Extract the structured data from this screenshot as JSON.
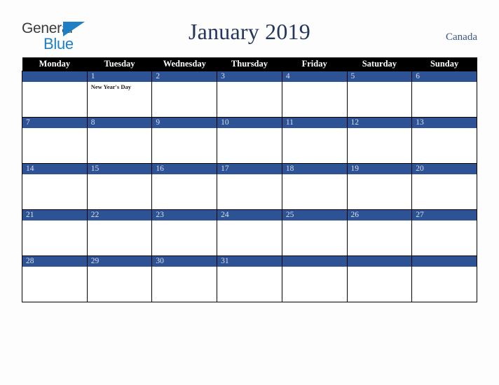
{
  "brand": {
    "name_part1": "General",
    "name_part2": "Blue",
    "triangle_color": "#1f7fc4",
    "text_color": "#3b3b3b"
  },
  "header": {
    "title": "January 2019",
    "region": "Canada",
    "title_color": "#23375e",
    "region_color": "#3c5484"
  },
  "calendar": {
    "month": "January",
    "year": "2019",
    "accent_color": "#2e5395",
    "header_bg": "#000000",
    "weekday_headers": [
      "Monday",
      "Tuesday",
      "Wednesday",
      "Thursday",
      "Friday",
      "Saturday",
      "Sunday"
    ],
    "weeks": [
      [
        {
          "day": "",
          "event": ""
        },
        {
          "day": "1",
          "event": "New Year's Day"
        },
        {
          "day": "2",
          "event": ""
        },
        {
          "day": "3",
          "event": ""
        },
        {
          "day": "4",
          "event": ""
        },
        {
          "day": "5",
          "event": ""
        },
        {
          "day": "6",
          "event": ""
        }
      ],
      [
        {
          "day": "7",
          "event": ""
        },
        {
          "day": "8",
          "event": ""
        },
        {
          "day": "9",
          "event": ""
        },
        {
          "day": "10",
          "event": ""
        },
        {
          "day": "11",
          "event": ""
        },
        {
          "day": "12",
          "event": ""
        },
        {
          "day": "13",
          "event": ""
        }
      ],
      [
        {
          "day": "14",
          "event": ""
        },
        {
          "day": "15",
          "event": ""
        },
        {
          "day": "16",
          "event": ""
        },
        {
          "day": "17",
          "event": ""
        },
        {
          "day": "18",
          "event": ""
        },
        {
          "day": "19",
          "event": ""
        },
        {
          "day": "20",
          "event": ""
        }
      ],
      [
        {
          "day": "21",
          "event": ""
        },
        {
          "day": "22",
          "event": ""
        },
        {
          "day": "23",
          "event": ""
        },
        {
          "day": "24",
          "event": ""
        },
        {
          "day": "25",
          "event": ""
        },
        {
          "day": "26",
          "event": ""
        },
        {
          "day": "27",
          "event": ""
        }
      ],
      [
        {
          "day": "28",
          "event": ""
        },
        {
          "day": "29",
          "event": ""
        },
        {
          "day": "30",
          "event": ""
        },
        {
          "day": "31",
          "event": ""
        },
        {
          "day": "",
          "event": ""
        },
        {
          "day": "",
          "event": ""
        },
        {
          "day": "",
          "event": ""
        }
      ]
    ]
  }
}
